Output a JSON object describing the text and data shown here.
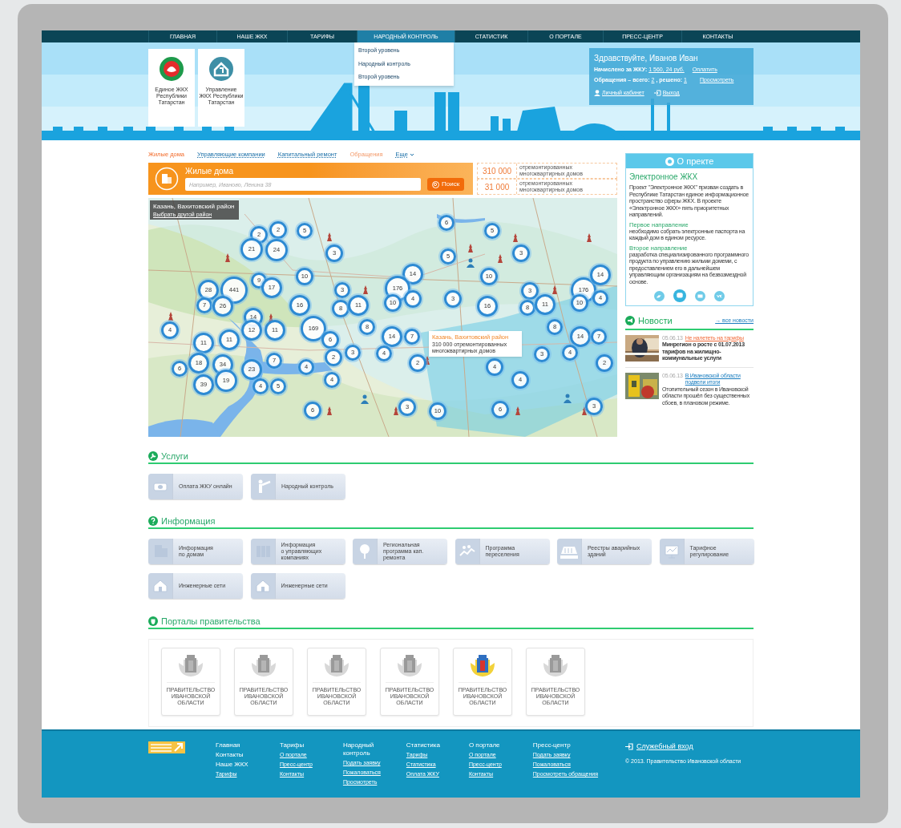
{
  "nav": [
    {
      "label": "ГЛАВНАЯ",
      "selected": false
    },
    {
      "label": "НАШЕ ЖКХ",
      "selected": false
    },
    {
      "label": "ТАРИФЫ",
      "selected": false
    },
    {
      "label": "НАРОДНЫЙ КОНТРОЛЬ",
      "selected": true,
      "dropdown": [
        "Второй уровень",
        "Народный контроль",
        "Второй уровень"
      ]
    },
    {
      "label": "СТАТИСТИК",
      "selected": false
    },
    {
      "label": "О ПОРТАЛЕ",
      "selected": false
    },
    {
      "label": "ПРЕСС-ЦЕНТР",
      "selected": false
    },
    {
      "label": "КОНТАКТЫ",
      "selected": false
    }
  ],
  "header": {
    "logos": [
      {
        "caption": "Единое ЖКХ Республики Татарстан"
      },
      {
        "caption": "Управление ЖКХ Республики Татарстан"
      }
    ],
    "user": {
      "greeting": "Здравствуйте, Иванов Иван",
      "charged_label": "Начислено за ЖКУ:",
      "charged_value": "1 560, 24 руб.",
      "pay": "Оплатить",
      "requests_label": "Обращения – всего:",
      "requests_total": "2",
      "resolved_label": ", решено:",
      "resolved": "1",
      "view": "Просмотреть",
      "cabinet": "Личный кабинет",
      "logout": "Выход"
    }
  },
  "tabs": [
    {
      "label": "Жилые дома",
      "selected": true,
      "kind": "link"
    },
    {
      "label": "Управляющие компании",
      "selected": false,
      "kind": "link"
    },
    {
      "label": "Капитальный ремонт",
      "selected": false,
      "kind": "link"
    },
    {
      "label": "Обращения",
      "selected": false,
      "kind": "accent"
    },
    {
      "label": "Еще",
      "selected": false,
      "kind": "dropdown"
    }
  ],
  "search": {
    "title": "Жилые дома",
    "placeholder": "Например, Иваново, Ленина 38",
    "button": "Поиск"
  },
  "stats": [
    {
      "value": "310 000",
      "label": "отремонтированных многоквартирных домов"
    },
    {
      "value": "31 000",
      "label": "отремонтированных многоквартирных домов"
    }
  ],
  "map": {
    "region": "Казань, Вахитовский район",
    "change": "Выбрать другой район",
    "tooltip": {
      "title": "Казань, Вахитовский район",
      "text": "310 000 отремонтированных многоквартирных домов"
    },
    "clusters": [
      "2",
      "2",
      "5",
      "21",
      "24",
      "3",
      "6",
      "5",
      "5",
      "3",
      "10",
      "9",
      "17",
      "28",
      "441",
      "7",
      "26",
      "3",
      "14",
      "176",
      "10",
      "4",
      "16",
      "8",
      "11",
      "3",
      "10",
      "16",
      "3",
      "8",
      "11",
      "176",
      "10",
      "14",
      "4",
      "4",
      "14",
      "12",
      "11",
      "169",
      "6",
      "8",
      "14",
      "7",
      "8",
      "14",
      "7",
      "11",
      "11",
      "7",
      "34",
      "18",
      "6",
      "23",
      "3",
      "2",
      "4",
      "4",
      "2",
      "39",
      "19",
      "4",
      "5",
      "4",
      "4",
      "3",
      "4",
      "2",
      "4",
      "6",
      "3",
      "10",
      "6",
      "3"
    ]
  },
  "about": {
    "title": "О пректе",
    "heading": "Электронное ЖКХ",
    "intro": "Проект \"Электронное ЖКХ\" призван создать в Республике Татарстан единое информационное пространство сферы ЖКХ. В проекте «Электронное ЖКХ» пять приоритетных направлений.",
    "sections": [
      {
        "title": "Первое направление",
        "text": "необходимо собрать электронные паспорта на каждый дом в едином ресурсе."
      },
      {
        "title": "Второе направление",
        "text": "разработка специализированного программного продукта по управлению жильми домеми, с предоставлением его в дальнейшем управляющим организациям на безвозмездной основе."
      }
    ]
  },
  "news": {
    "title": "Новости",
    "all": "→ все новости",
    "items": [
      {
        "date": "05.06.13",
        "title": "Не налететь на тарифы",
        "color": "#f26b3a",
        "text": "Минрегион о росте с 01.07.2013 тарифов на жилищно-коммунальные услуги",
        "bold": true
      },
      {
        "date": "05.06.13",
        "title": "В Ивановской области подвели итоги",
        "color": "#1a7dbf",
        "text": "Отопительный сезон в Ивановской области прошёл без существенных сбоев, в плановом режиме.",
        "bold": false
      }
    ]
  },
  "services": {
    "title": "Услуги",
    "items": [
      "Оплата ЖКУ онлайн",
      "Народный контроль"
    ]
  },
  "information": {
    "title": "Информация",
    "items": [
      "Информация\nпо домам",
      "Информация\nо управляющих\nкомпаниях",
      "Региональная\nпрограмма кап.\nремонта",
      "Программа\nпереселения",
      "Реестры аварийных\nзданий",
      "Тарифное\nрегулирование",
      "Инженерные сети",
      "Инженерные сети"
    ]
  },
  "portals": {
    "title": "Порталы правительства",
    "items": [
      {
        "label": "ПРАВИТЕЛЬСТВО ИВАНОВСКОЙ ОБЛАСТИ",
        "selected": false
      },
      {
        "label": "ПРАВИТЕЛЬСТВО ИВАНОВСКОЙ ОБЛАСТИ",
        "selected": false
      },
      {
        "label": "ПРАВИТЕЛЬСТВО ИВАНОВСКОЙ ОБЛАСТИ",
        "selected": false
      },
      {
        "label": "ПРАВИТЕЛЬСТВО ИВАНОВСКОЙ ОБЛАСТИ",
        "selected": false
      },
      {
        "label": "ПРАВИТЕЛЬСТВО ИВАНОВСКОЙ ОБЛАСТИ",
        "selected": true
      },
      {
        "label": "ПРАВИТЕЛЬСТВО ИВАНОВСКОЙ ОБЛАСТИ",
        "selected": false
      }
    ]
  },
  "footer": {
    "columns": [
      [
        {
          "text": "Главная",
          "kind": "heading"
        },
        {
          "text": "Контакты",
          "kind": "heading"
        },
        {
          "text": "Наше ЖКХ",
          "kind": "heading"
        },
        {
          "text": "Тарифы",
          "kind": "link"
        }
      ],
      [
        {
          "text": "Тарифы",
          "kind": "heading"
        },
        {
          "text": "О портале",
          "kind": "link"
        },
        {
          "text": "Пресс-центр",
          "kind": "link"
        },
        {
          "text": "Контакты",
          "kind": "link"
        }
      ],
      [
        {
          "text": "Народный контроль",
          "kind": "heading"
        },
        {
          "text": "Подать заявку",
          "kind": "link"
        },
        {
          "text": "Пожаловаться",
          "kind": "link"
        },
        {
          "text": "Просмотреть",
          "kind": "link"
        }
      ],
      [
        {
          "text": "Статистика",
          "kind": "heading"
        },
        {
          "text": "Тарифы",
          "kind": "link"
        },
        {
          "text": "Статистика",
          "kind": "link"
        },
        {
          "text": "Оплата ЖКУ",
          "kind": "link"
        }
      ],
      [
        {
          "text": "О портале",
          "kind": "heading"
        },
        {
          "text": "О портале",
          "kind": "link"
        },
        {
          "text": "Пресс-центр",
          "kind": "link"
        },
        {
          "text": "Контакты",
          "kind": "link"
        }
      ],
      [
        {
          "text": "Пресс-центр",
          "kind": "heading"
        },
        {
          "text": "Подать заявку",
          "kind": "link"
        },
        {
          "text": "Пожаловаться",
          "kind": "link"
        },
        {
          "text": "Просмотреть обращения",
          "kind": "link"
        }
      ]
    ],
    "login": "Служебный вход",
    "copyright": "© 2013. Правительство Ивановской области"
  }
}
